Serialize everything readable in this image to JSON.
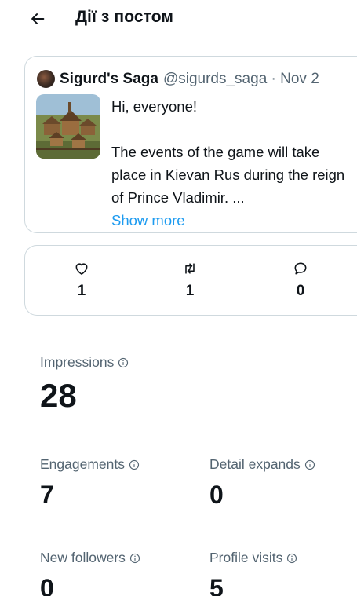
{
  "header": {
    "title": "Дії з постом",
    "back_icon": "arrow-left-icon"
  },
  "post": {
    "author_name": "Sigurd's Saga",
    "author_meta": "@sigurds_saga · Nov 2",
    "text": "Hi, everyone!\n\n The events of the game will take place in Kievan Rus during the reign of Prince Vladimir. ...",
    "show_more": "Show more"
  },
  "engagement_counts": {
    "likes": "1",
    "reposts": "1",
    "replies": "0"
  },
  "metrics": {
    "impressions": {
      "label": "Impressions",
      "value": "28"
    },
    "engagements": {
      "label": "Engagements",
      "value": "7"
    },
    "detail_expands": {
      "label": "Detail expands",
      "value": "0"
    },
    "new_followers": {
      "label": "New followers",
      "value": "0"
    },
    "profile_visits": {
      "label": "Profile visits",
      "value": "5"
    }
  },
  "colors": {
    "accent": "#1d9bf0",
    "secondary_text": "#536471",
    "border": "#cfd9de"
  }
}
